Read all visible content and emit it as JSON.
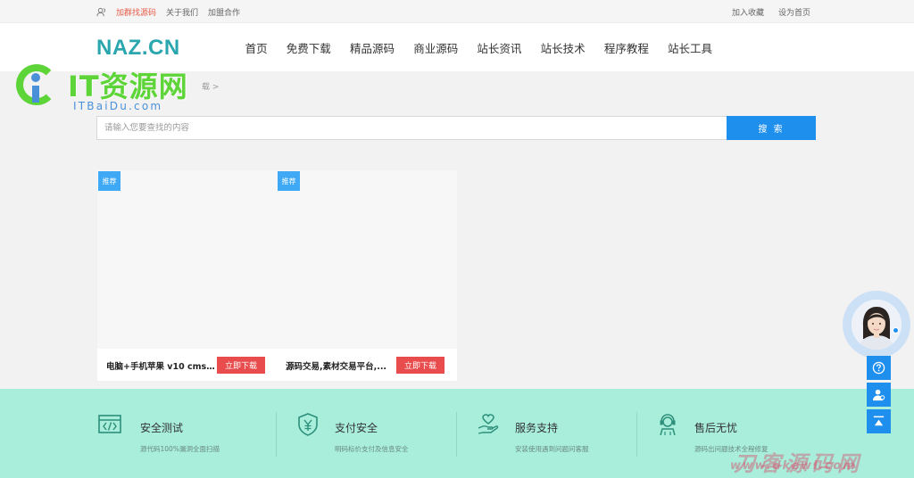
{
  "topbar": {
    "links_left": [
      "加群找源码",
      "关于我们",
      "加盟合作"
    ],
    "links_right": [
      "加入收藏",
      "设为首页"
    ]
  },
  "header": {
    "logo": "NAZ.CN",
    "nav": [
      "首页",
      "免费下载",
      "精品源码",
      "商业源码",
      "站长资讯",
      "站长技术",
      "程序教程",
      "站长工具"
    ]
  },
  "breadcrumb": "载 >",
  "search": {
    "placeholder": "请输入您要查找的内容",
    "button": "搜 索"
  },
  "cards": [
    {
      "badge": "推荐",
      "title": "电脑+手机苹果 v10 cms...",
      "button": "立即下载"
    },
    {
      "badge": "推荐",
      "title": "源码交易,素材交易平台,...",
      "button": "立即下载"
    }
  ],
  "features": [
    {
      "icon": "code-window-icon",
      "title": "安全测试",
      "desc": "源代码100%漏洞全面扫描"
    },
    {
      "icon": "shield-yen-icon",
      "title": "支付安全",
      "desc": "明码标价支付及信息安全"
    },
    {
      "icon": "heart-hand-icon",
      "title": "服务支持",
      "desc": "安装使用遇到问题问客服"
    },
    {
      "icon": "headset-agent-icon",
      "title": "售后无忧",
      "desc": "源码出问题技术全程修复"
    }
  ],
  "watermark_top": {
    "name": "IT资源网",
    "url": "ITBaiDu.com"
  },
  "watermark_bottom": {
    "name": "刀客源码网",
    "url": "www.dkewl.com"
  },
  "side_tools": [
    "question-circle-icon",
    "user-service-icon",
    "back-to-top-icon"
  ],
  "colors": {
    "accent_blue": "#1f8fee",
    "download_red": "#e84c4c",
    "footer_mint": "#a8eedb",
    "logo_teal": "#2aa6ae",
    "badge_blue": "#3fa9f5",
    "watermark_green": "#5dd437"
  }
}
